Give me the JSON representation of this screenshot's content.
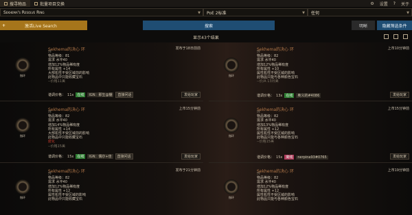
{
  "tabs": [
    {
      "label": "搜寻物品"
    },
    {
      "label": "批量项目交换"
    }
  ],
  "top_right": {
    "settings": "设置",
    "help": "?",
    "about": "关于"
  },
  "search": {
    "item": "Sekhema's Resolve Ring",
    "league": "PoE 2标准",
    "status": "任何"
  },
  "buttons": {
    "live": "激活Live Search",
    "search": "搜索",
    "clear": "明晰",
    "filters": "隐藏筛选条件"
  },
  "result_title": "显示43个结果",
  "cards": [
    {
      "name": "Sekhema的决心 环",
      "thumb_label": "指环",
      "listed": "发布于18日前前",
      "lines": [
        "环",
        "物品等级：81",
        "需求 水平40",
        "增加12%物品稀有度",
        "所有属性 +14",
        "大部机性不受区域前的影响",
        "此物品中只能收藏宝石"
      ],
      "price_line": "--价格11美",
      "foot": {
        "label": "谐调价格：",
        "qty": "11x",
        "tag": "在线",
        "ign": "IGN：那生@棚",
        "btn": "直接问话"
      },
      "whisper": "发给玩家"
    },
    {
      "name": "Sekhema的决心 环",
      "thumb_label": "指环",
      "listed": "上市10分钟前",
      "lines": [
        "环",
        "物品等级：82",
        "需求 水平40",
        "增加12%物品稀有度",
        "所有属性 +10",
        "属性机性不受区域的影响",
        "此物品只能与各种颜色宝石"
      ],
      "price_line": "--价/A 13月美",
      "foot": {
        "label": "谐调价格：",
        "qty": "13x",
        "tag": "在线",
        "ign": "奥义的#4086",
        "btn": ""
      },
      "whisper": "发给玩家"
    },
    {
      "name": "Sekhema的决心 环",
      "thumb_label": "指环",
      "listed": "上市15分钟前",
      "lines": [
        "环",
        "物品等级：82",
        "需求 水平40",
        "增加14%物品稀有度",
        "所有属性 +14",
        "大部机性不受区域前的影响",
        "此物品中只能收藏宝石",
        "腐化"
      ],
      "price_line": "--价格15美",
      "foot": {
        "label": "谐调价格：",
        "qty": "15x",
        "tag": "在线",
        "ign": "IGN：偶尔+佳",
        "btn": "直接问话"
      },
      "whisper": "发给玩家"
    },
    {
      "name": "Sekhema的决心 环",
      "thumb_label": "指环",
      "listed": "上市15分钟前",
      "lines": [
        "环",
        "物品等级：82",
        "需求 水平40",
        "增加13%物品稀有度",
        "所有属性 +12",
        "属性机性不受区域的影响",
        "此物品只能与各种颜色宝石"
      ],
      "price_line": "--价格15美",
      "foot": {
        "label": "谐调价格：",
        "qty": "15x",
        "tag": "离线",
        "ign": "nerpina93#0765",
        "btn": ""
      },
      "whisper": "发给玩家"
    },
    {
      "name": "Sekhema的决心 环",
      "thumb_label": "指环",
      "listed": "发布于21分钟前",
      "lines": [
        "环",
        "物品等级：82",
        "需求 水平40",
        "增加12%物品稀有度",
        "所有属性 +12",
        "属性机性不受区域的影响",
        "此物品中只能收藏宝石"
      ],
      "price_line": "",
      "foot": {
        "label": "",
        "qty": "",
        "tag": "",
        "ign": "",
        "btn": ""
      },
      "whisper": ""
    },
    {
      "name": "Sekhema的决心 环",
      "thumb_label": "指环",
      "listed": "上市19分钟前",
      "lines": [
        "环",
        "物品等级：82",
        "需求 水平40",
        "增加12%物品稀有度",
        "所有属性 +12",
        "属性机性不受区域的影响",
        "此物品只能与各种颜色宝石"
      ],
      "price_line": "",
      "foot": {
        "label": "",
        "qty": "",
        "tag": "",
        "ign": "",
        "btn": ""
      },
      "whisper": ""
    }
  ]
}
